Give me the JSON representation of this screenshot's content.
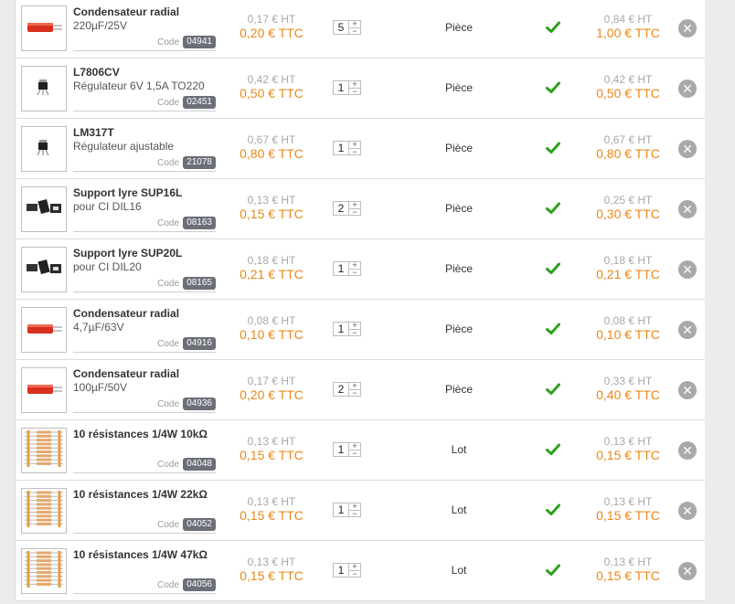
{
  "cart": {
    "code_label": "Code",
    "items": [
      {
        "name": "Condensateur radial",
        "desc": "220µF/25V",
        "code": "04941",
        "unit_ht": "0,17 € HT",
        "unit_ttc": "0,20 € TTC",
        "qty": "5",
        "unit": "Pièce",
        "total_ht": "0,84 € HT",
        "total_ttc": "1,00 € TTC",
        "thumb": "capacitor-icon"
      },
      {
        "name": "L7806CV",
        "desc": "Régulateur 6V 1,5A TO220",
        "code": "02451",
        "unit_ht": "0,42 € HT",
        "unit_ttc": "0,50 € TTC",
        "qty": "1",
        "unit": "Pièce",
        "total_ht": "0,42 € HT",
        "total_ttc": "0,50 € TTC",
        "thumb": "regulator-icon"
      },
      {
        "name": "LM317T",
        "desc": "Régulateur ajustable",
        "code": "21078",
        "unit_ht": "0,67 € HT",
        "unit_ttc": "0,80 € TTC",
        "qty": "1",
        "unit": "Pièce",
        "total_ht": "0,67 € HT",
        "total_ttc": "0,80 € TTC",
        "thumb": "regulator-icon"
      },
      {
        "name": "Support lyre SUP16L",
        "desc": "pour CI DIL16",
        "code": "08163",
        "unit_ht": "0,13 € HT",
        "unit_ttc": "0,15 € TTC",
        "qty": "2",
        "unit": "Pièce",
        "total_ht": "0,25 € HT",
        "total_ttc": "0,30 € TTC",
        "thumb": "ic-socket-icon"
      },
      {
        "name": "Support lyre SUP20L",
        "desc": "pour CI DIL20",
        "code": "08165",
        "unit_ht": "0,18 € HT",
        "unit_ttc": "0,21 € TTC",
        "qty": "1",
        "unit": "Pièce",
        "total_ht": "0,18 € HT",
        "total_ttc": "0,21 € TTC",
        "thumb": "ic-socket-icon"
      },
      {
        "name": "Condensateur radial",
        "desc": "4,7µF/63V",
        "code": "04916",
        "unit_ht": "0,08 € HT",
        "unit_ttc": "0,10 € TTC",
        "qty": "1",
        "unit": "Pièce",
        "total_ht": "0,08 € HT",
        "total_ttc": "0,10 € TTC",
        "thumb": "capacitor-icon"
      },
      {
        "name": "Condensateur radial",
        "desc": "100µF/50V",
        "code": "04936",
        "unit_ht": "0,17 € HT",
        "unit_ttc": "0,20 € TTC",
        "qty": "2",
        "unit": "Pièce",
        "total_ht": "0,33 € HT",
        "total_ttc": "0,40 € TTC",
        "thumb": "capacitor-icon"
      },
      {
        "name": "10 résistances 1/4W 10kΩ",
        "desc": "",
        "code": "04048",
        "unit_ht": "0,13 € HT",
        "unit_ttc": "0,15 € TTC",
        "qty": "1",
        "unit": "Lot",
        "total_ht": "0,13 € HT",
        "total_ttc": "0,15 € TTC",
        "thumb": "resistors-icon"
      },
      {
        "name": "10 résistances 1/4W 22kΩ",
        "desc": "",
        "code": "04052",
        "unit_ht": "0,13 € HT",
        "unit_ttc": "0,15 € TTC",
        "qty": "1",
        "unit": "Lot",
        "total_ht": "0,13 € HT",
        "total_ttc": "0,15 € TTC",
        "thumb": "resistors-icon"
      },
      {
        "name": "10 résistances 1/4W 47kΩ",
        "desc": "",
        "code": "04056",
        "unit_ht": "0,13 € HT",
        "unit_ttc": "0,15 € TTC",
        "qty": "1",
        "unit": "Lot",
        "total_ht": "0,13 € HT",
        "total_ttc": "0,15 € TTC",
        "thumb": "resistors-icon"
      }
    ]
  },
  "colors": {
    "ttc": "#e8881a",
    "ht": "#a8a8a8",
    "check": "#2ea01e",
    "code_badge": "#6b6f78"
  },
  "icons": {
    "stock": "check-icon",
    "remove": "close-icon",
    "spinner": "plus-minus-spinner"
  }
}
